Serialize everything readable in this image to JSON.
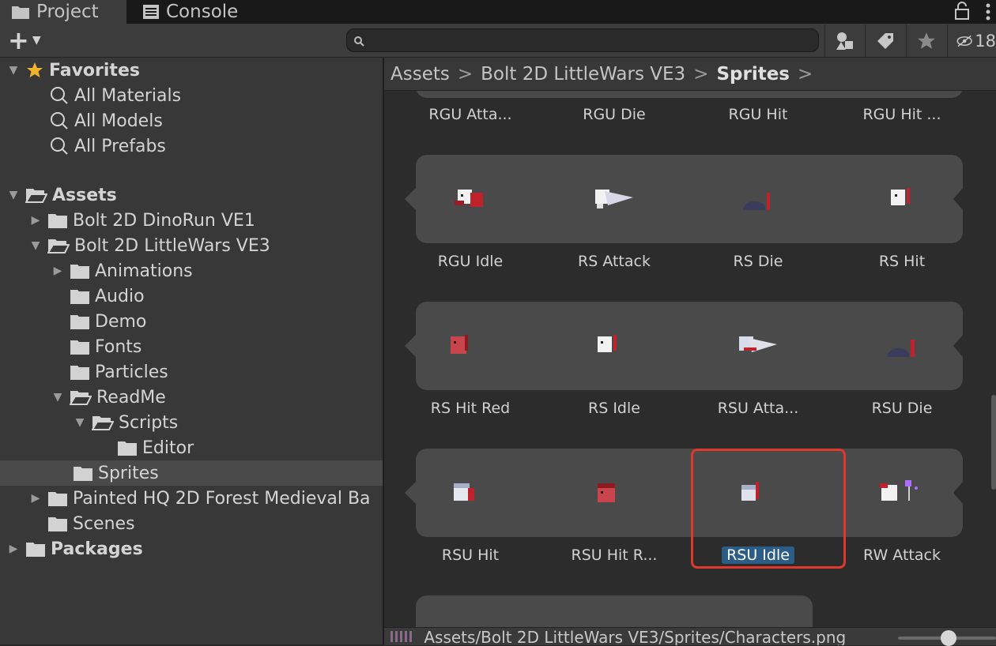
{
  "tabs": {
    "project": "Project",
    "console": "Console"
  },
  "toolbar": {
    "add_label": "+",
    "search_placeholder": "",
    "hidden_count": "18"
  },
  "favorites": {
    "title": "Favorites",
    "items": [
      "All Materials",
      "All Models",
      "All Prefabs"
    ]
  },
  "tree": {
    "assets": "Assets",
    "dinorun": "Bolt 2D DinoRun VE1",
    "littlewars": "Bolt 2D LittleWars VE3",
    "animations": "Animations",
    "audio": "Audio",
    "demo": "Demo",
    "fonts": "Fonts",
    "particles": "Particles",
    "readme": "ReadMe",
    "scripts": "Scripts",
    "editor": "Editor",
    "sprites": "Sprites",
    "forest": "Painted HQ 2D Forest Medieval Ba",
    "scenes": "Scenes",
    "packages": "Packages"
  },
  "breadcrumb": [
    "Assets",
    "Bolt 2D LittleWars VE3",
    "Sprites"
  ],
  "grid": {
    "row0": [
      "RGU Atta...",
      "RGU Die",
      "RGU Hit",
      "RGU Hit ..."
    ],
    "row1": [
      "RGU Idle",
      "RS Attack",
      "RS Die",
      "RS Hit"
    ],
    "row2": [
      "RS Hit Red",
      "RS Idle",
      "RSU Atta...",
      "RSU Die"
    ],
    "row3": [
      "RSU Hit",
      "RSU Hit R...",
      "RSU Idle",
      "RW Attack"
    ]
  },
  "status": {
    "path": "Assets/Bolt 2D LittleWars VE3/Sprites/Characters.png"
  },
  "colors": {
    "selection": "#2c5d87",
    "highlight_box": "#e0392b",
    "favorite_star": "#f0b429"
  }
}
